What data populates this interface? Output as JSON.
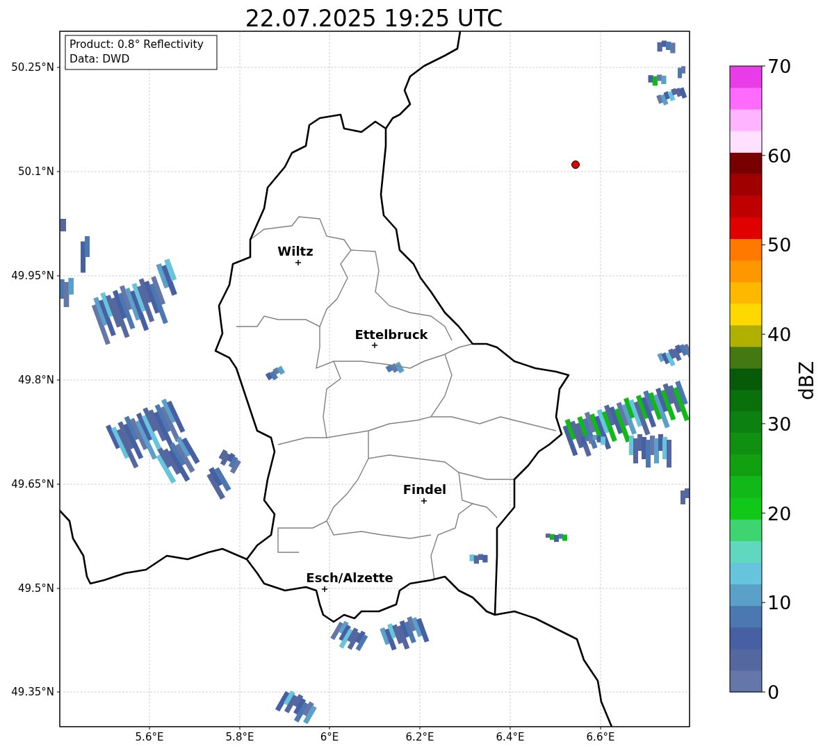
{
  "title": "22.07.2025 19:25 UTC",
  "info_box": {
    "lines": [
      "Product: 0.8° Reflectivity",
      "Data: DWD"
    ]
  },
  "map": {
    "y_ticks": [
      "50.25°N",
      "50.1°N",
      "49.95°N",
      "49.8°N",
      "49.65°N",
      "49.5°N",
      "49.35°N"
    ],
    "x_ticks": [
      "5.6°E",
      "5.8°E",
      "6°E",
      "6.2°E",
      "6.4°E",
      "6.6°E"
    ],
    "places": [
      {
        "name": "Wiltz"
      },
      {
        "name": "Ettelbruck"
      },
      {
        "name": "Findel"
      },
      {
        "name": "Esch/Alzette"
      }
    ]
  },
  "colorbar": {
    "label": "dBZ",
    "ticks": [
      "70",
      "60",
      "50",
      "40",
      "30",
      "20",
      "10",
      "0"
    ],
    "bins": [
      {
        "color": "#6477a8"
      },
      {
        "color": "#54689f"
      },
      {
        "color": "#4660a3"
      },
      {
        "color": "#4b78b0"
      },
      {
        "color": "#5aa0c8"
      },
      {
        "color": "#66c4dc"
      },
      {
        "color": "#60d8c0"
      },
      {
        "color": "#3ed470"
      },
      {
        "color": "#10c818"
      },
      {
        "color": "#10b818"
      },
      {
        "color": "#10a010"
      },
      {
        "color": "#0f9010"
      },
      {
        "color": "#0c8010"
      },
      {
        "color": "#0a700c"
      },
      {
        "color": "#065a08"
      },
      {
        "color": "#447810"
      },
      {
        "color": "#b0b000"
      },
      {
        "color": "#ffd800"
      },
      {
        "color": "#ffb800"
      },
      {
        "color": "#ff9800"
      },
      {
        "color": "#ff7800"
      },
      {
        "color": "#e00000"
      },
      {
        "color": "#c00000"
      },
      {
        "color": "#a00000"
      },
      {
        "color": "#780000"
      },
      {
        "color": "#ffe0ff"
      },
      {
        "color": "#ffb4ff"
      },
      {
        "color": "#ff6aff"
      },
      {
        "color": "#e83ce8"
      }
    ]
  }
}
